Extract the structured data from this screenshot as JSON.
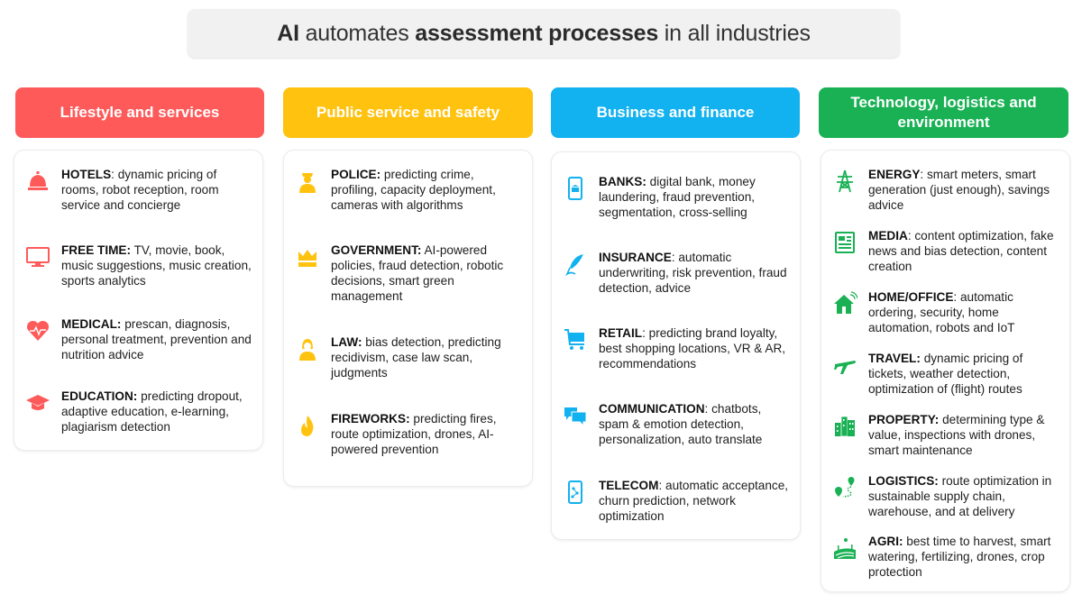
{
  "title": {
    "part1_bold": "AI",
    "part2": " automates ",
    "part3_bold": "assessment processes",
    "part4": " in all industries"
  },
  "colors": {
    "red": "#fe5a5a",
    "yellow": "#ffc20e",
    "blue": "#12b1ef",
    "green": "#19b154"
  },
  "columns": [
    {
      "header": "Lifestyle and services",
      "items": [
        {
          "icon": "bell-icon",
          "key": "HOTELS",
          "sep": ": ",
          "text": "dynamic pricing of rooms, robot reception, room service and concierge"
        },
        {
          "icon": "monitor-icon",
          "key": "FREE TIME:",
          "sep": " ",
          "text": "TV, movie, book, music suggestions, music creation, sports analytics"
        },
        {
          "icon": "heart-pulse-icon",
          "key": "MEDICAL:",
          "sep": " ",
          "text": "prescan, diagnosis, personal treatment, prevention and nutrition advice"
        },
        {
          "icon": "graduation-cap-icon",
          "key": "EDUCATION:",
          "sep": " ",
          "text": "predicting dropout, adaptive education, e-learning, plagiarism detection"
        }
      ]
    },
    {
      "header": "Public service and safety",
      "items": [
        {
          "icon": "police-officer-icon",
          "key": "POLICE:",
          "sep": " ",
          "text": "predicting crime, profiling, capacity deployment, cameras with algorithms"
        },
        {
          "icon": "crown-icon",
          "key": "GOVERNMENT:",
          "sep": " ",
          "text": "AI-powered policies, fraud detection, robotic decisions, smart green management"
        },
        {
          "icon": "judge-icon",
          "key": "LAW:",
          "sep": " ",
          "text": "bias detection, predicting recidivism, case law scan, judgments"
        },
        {
          "icon": "fire-icon",
          "key": "FIREWORKS:",
          "sep": " ",
          "text": "predicting fires, route optimization, drones, AI-powered prevention"
        }
      ]
    },
    {
      "header": "Business and finance",
      "items": [
        {
          "icon": "mobile-bank-icon",
          "key": "BANKS:",
          "sep": " ",
          "text": "digital bank, money laundering, fraud prevention, segmentation, cross-selling"
        },
        {
          "icon": "feather-pen-icon",
          "key": "INSURANCE",
          "sep": ": ",
          "text": "automatic underwriting, risk prevention, fraud detection, advice"
        },
        {
          "icon": "shopping-cart-icon",
          "key": "RETAIL",
          "sep": ": ",
          "text": "predicting brand loyalty, best shopping locations, VR & AR, recommendations"
        },
        {
          "icon": "chat-bubbles-icon",
          "key": "COMMUNICATION",
          "sep": ": ",
          "text": "chatbots, spam & emotion detection, personalization, auto translate"
        },
        {
          "icon": "mobile-network-icon",
          "key": "TELECOM",
          "sep": ": ",
          "text": "automatic acceptance, churn prediction, network optimization"
        }
      ]
    },
    {
      "header": "Technology, logistics and environment",
      "items": [
        {
          "icon": "power-tower-icon",
          "key": "ENERGY",
          "sep": ": ",
          "text": "smart meters, smart generation (just enough), savings advice"
        },
        {
          "icon": "newspaper-icon",
          "key": "MEDIA",
          "sep": ": ",
          "text": "content optimization, fake news and bias detection, content creation"
        },
        {
          "icon": "smart-home-icon",
          "key": "HOME/OFFICE",
          "sep": ": ",
          "text": "automatic ordering, security, home automation, robots and IoT"
        },
        {
          "icon": "airplane-icon",
          "key": "TRAVEL:",
          "sep": " ",
          "text": "dynamic pricing of tickets, weather detection, optimization of (flight) routes"
        },
        {
          "icon": "buildings-icon",
          "key": "PROPERTY:",
          "sep": " ",
          "text": "determining type & value, inspections with drones, smart maintenance"
        },
        {
          "icon": "route-pin-icon",
          "key": "LOGISTICS:",
          "sep": " ",
          "text": "route optimization in sustainable supply chain, warehouse, and at delivery"
        },
        {
          "icon": "farm-field-icon",
          "key": "AGRI:",
          "sep": " ",
          "text": "best time to harvest, smart watering, fertilizing, drones, crop protection"
        }
      ]
    }
  ]
}
